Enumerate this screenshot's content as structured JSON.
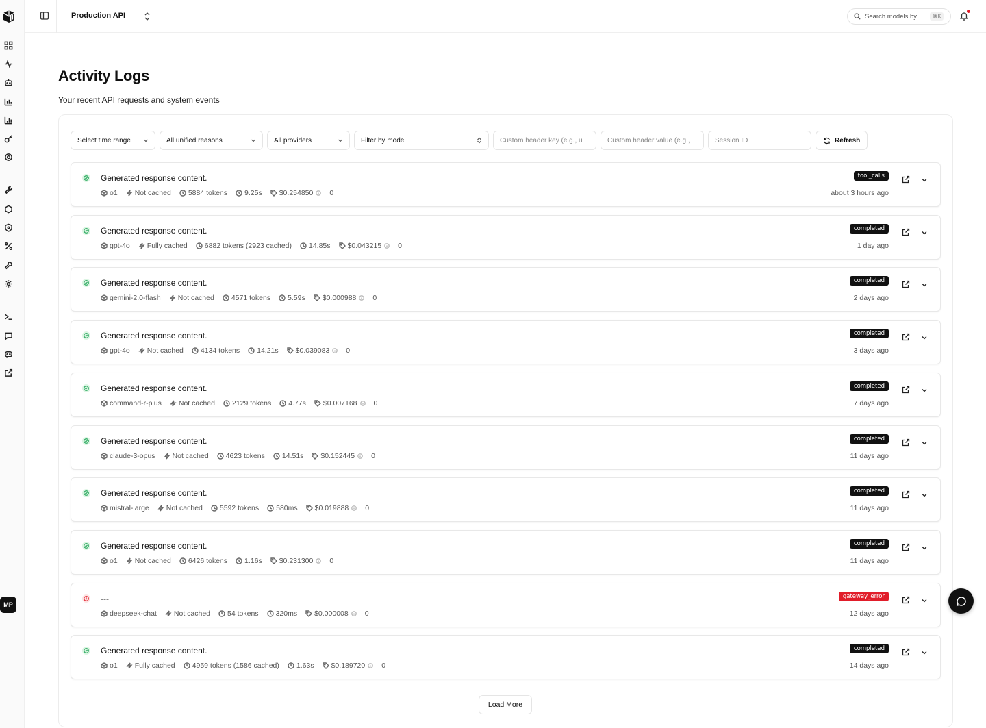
{
  "colors": {
    "accent": "#111111",
    "success_bg": "#dcf5e3",
    "success": "#22a559",
    "error": "#e11d2a"
  },
  "sidebar": {
    "logo_icon": "cube-logo-icon",
    "items": [
      {
        "icon": "dashboard-icon"
      },
      {
        "icon": "activity-icon"
      },
      {
        "icon": "bot-icon"
      },
      {
        "icon": "bar-chart-icon"
      },
      {
        "icon": "chart-icon"
      },
      {
        "icon": "key-icon"
      },
      {
        "icon": "settings-icon"
      },
      {
        "icon": "wrench-icon"
      },
      {
        "icon": "hexagon-icon"
      },
      {
        "icon": "shield-icon"
      },
      {
        "icon": "percent-icon"
      },
      {
        "icon": "tool-icon"
      },
      {
        "icon": "cog-icon"
      },
      {
        "icon": "terminal-icon"
      },
      {
        "icon": "message-icon"
      },
      {
        "icon": "chat-bot-icon"
      },
      {
        "icon": "external-link-icon"
      }
    ],
    "avatar_initials": "MP"
  },
  "header": {
    "project": "Production API",
    "search_placeholder": "Search models by ...",
    "search_shortcut": "⌘K"
  },
  "page": {
    "title": "Activity Logs",
    "subtitle": "Your recent API requests and system events"
  },
  "filters": {
    "time_range": "Select time range",
    "unified_reasons": "All unified reasons",
    "providers": "All providers",
    "model": "Filter by model",
    "header_key_placeholder": "Custom header key (e.g., u",
    "header_value_placeholder": "Custom header value (e.g.,",
    "session_placeholder": "Session ID",
    "refresh_label": "Refresh"
  },
  "logs": [
    {
      "status": "ok",
      "title": "Generated response content.",
      "model": "o1",
      "cache": "Not cached",
      "tokens": "5884 tokens",
      "duration": "9.25s",
      "cost": "$0.254850",
      "extra": "0",
      "badge": "tool_calls",
      "badge_type": "default",
      "when": "about 3 hours ago"
    },
    {
      "status": "ok",
      "title": "Generated response content.",
      "model": "gpt-4o",
      "cache": "Fully cached",
      "tokens": "6882 tokens (2923 cached)",
      "duration": "14.85s",
      "cost": "$0.043215",
      "extra": "0",
      "badge": "completed",
      "badge_type": "default",
      "when": "1 day ago"
    },
    {
      "status": "ok",
      "title": "Generated response content.",
      "model": "gemini-2.0-flash",
      "cache": "Not cached",
      "tokens": "4571 tokens",
      "duration": "5.59s",
      "cost": "$0.000988",
      "extra": "0",
      "badge": "completed",
      "badge_type": "default",
      "when": "2 days ago"
    },
    {
      "status": "ok",
      "title": "Generated response content.",
      "model": "gpt-4o",
      "cache": "Not cached",
      "tokens": "4134 tokens",
      "duration": "14.21s",
      "cost": "$0.039083",
      "extra": "0",
      "badge": "completed",
      "badge_type": "default",
      "when": "3 days ago"
    },
    {
      "status": "ok",
      "title": "Generated response content.",
      "model": "command-r-plus",
      "cache": "Not cached",
      "tokens": "2129 tokens",
      "duration": "4.77s",
      "cost": "$0.007168",
      "extra": "0",
      "badge": "completed",
      "badge_type": "default",
      "when": "7 days ago"
    },
    {
      "status": "ok",
      "title": "Generated response content.",
      "model": "claude-3-opus",
      "cache": "Not cached",
      "tokens": "4623 tokens",
      "duration": "14.51s",
      "cost": "$0.152445",
      "extra": "0",
      "badge": "completed",
      "badge_type": "default",
      "when": "11 days ago"
    },
    {
      "status": "ok",
      "title": "Generated response content.",
      "model": "mistral-large",
      "cache": "Not cached",
      "tokens": "5592 tokens",
      "duration": "580ms",
      "cost": "$0.019888",
      "extra": "0",
      "badge": "completed",
      "badge_type": "default",
      "when": "11 days ago"
    },
    {
      "status": "ok",
      "title": "Generated response content.",
      "model": "o1",
      "cache": "Not cached",
      "tokens": "6426 tokens",
      "duration": "1.16s",
      "cost": "$0.231300",
      "extra": "0",
      "badge": "completed",
      "badge_type": "default",
      "when": "11 days ago"
    },
    {
      "status": "err",
      "title": "---",
      "model": "deepseek-chat",
      "cache": "Not cached",
      "tokens": "54 tokens",
      "duration": "320ms",
      "cost": "$0.000008",
      "extra": "0",
      "badge": "gateway_error",
      "badge_type": "error",
      "when": "12 days ago"
    },
    {
      "status": "ok",
      "title": "Generated response content.",
      "model": "o1",
      "cache": "Fully cached",
      "tokens": "4959 tokens (1586 cached)",
      "duration": "1.63s",
      "cost": "$0.189720",
      "extra": "0",
      "badge": "completed",
      "badge_type": "default",
      "when": "14 days ago"
    }
  ],
  "load_more_label": "Load More",
  "chat_fab_icon": "chat-bubble-icon"
}
